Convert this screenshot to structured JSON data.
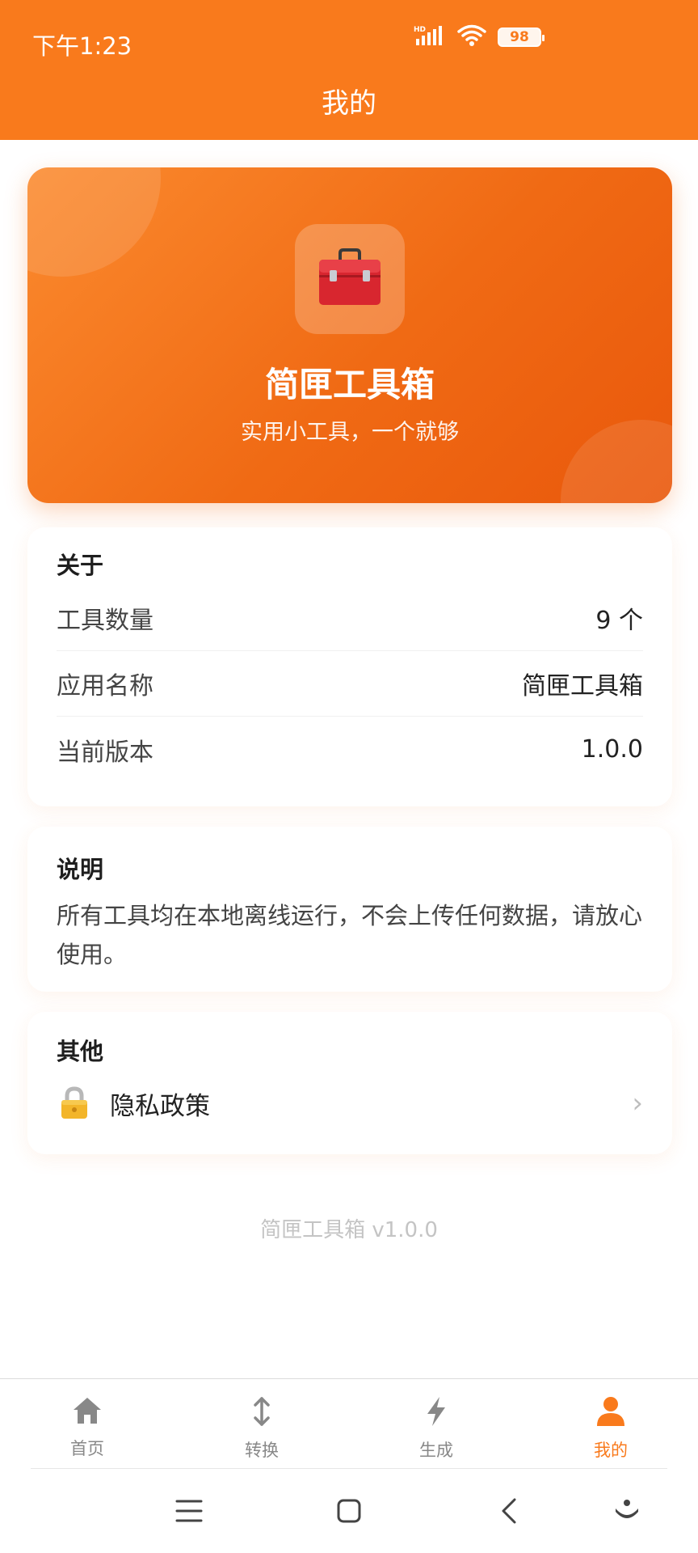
{
  "status": {
    "time": "下午1:23",
    "network": "HD",
    "battery": "98"
  },
  "header": {
    "title": "我的"
  },
  "hero": {
    "app_name": "简匣工具箱",
    "slogan": "实用小工具，一个就够",
    "icon": "toolbox-icon"
  },
  "about": {
    "title": "关于",
    "rows": [
      {
        "label": "工具数量",
        "value": "9 个"
      },
      {
        "label": "应用名称",
        "value": "简匣工具箱"
      },
      {
        "label": "当前版本",
        "value": "1.0.0"
      }
    ]
  },
  "description": {
    "title": "说明",
    "text": "所有工具均在本地离线运行，不会上传任何数据，请放心使用。"
  },
  "other": {
    "title": "其他",
    "privacy_label": "隐私政策",
    "chevron": "›"
  },
  "footer": {
    "version_text": "简匣工具箱 v1.0.0"
  },
  "tabs": [
    {
      "label": "首页",
      "icon": "home-icon",
      "active": false
    },
    {
      "label": "转换",
      "icon": "swap-vertical-icon",
      "active": false
    },
    {
      "label": "生成",
      "icon": "lightning-icon",
      "active": false
    },
    {
      "label": "我的",
      "icon": "person-icon",
      "active": true
    }
  ],
  "colors": {
    "accent": "#f97a1c",
    "inactive": "#888888"
  }
}
